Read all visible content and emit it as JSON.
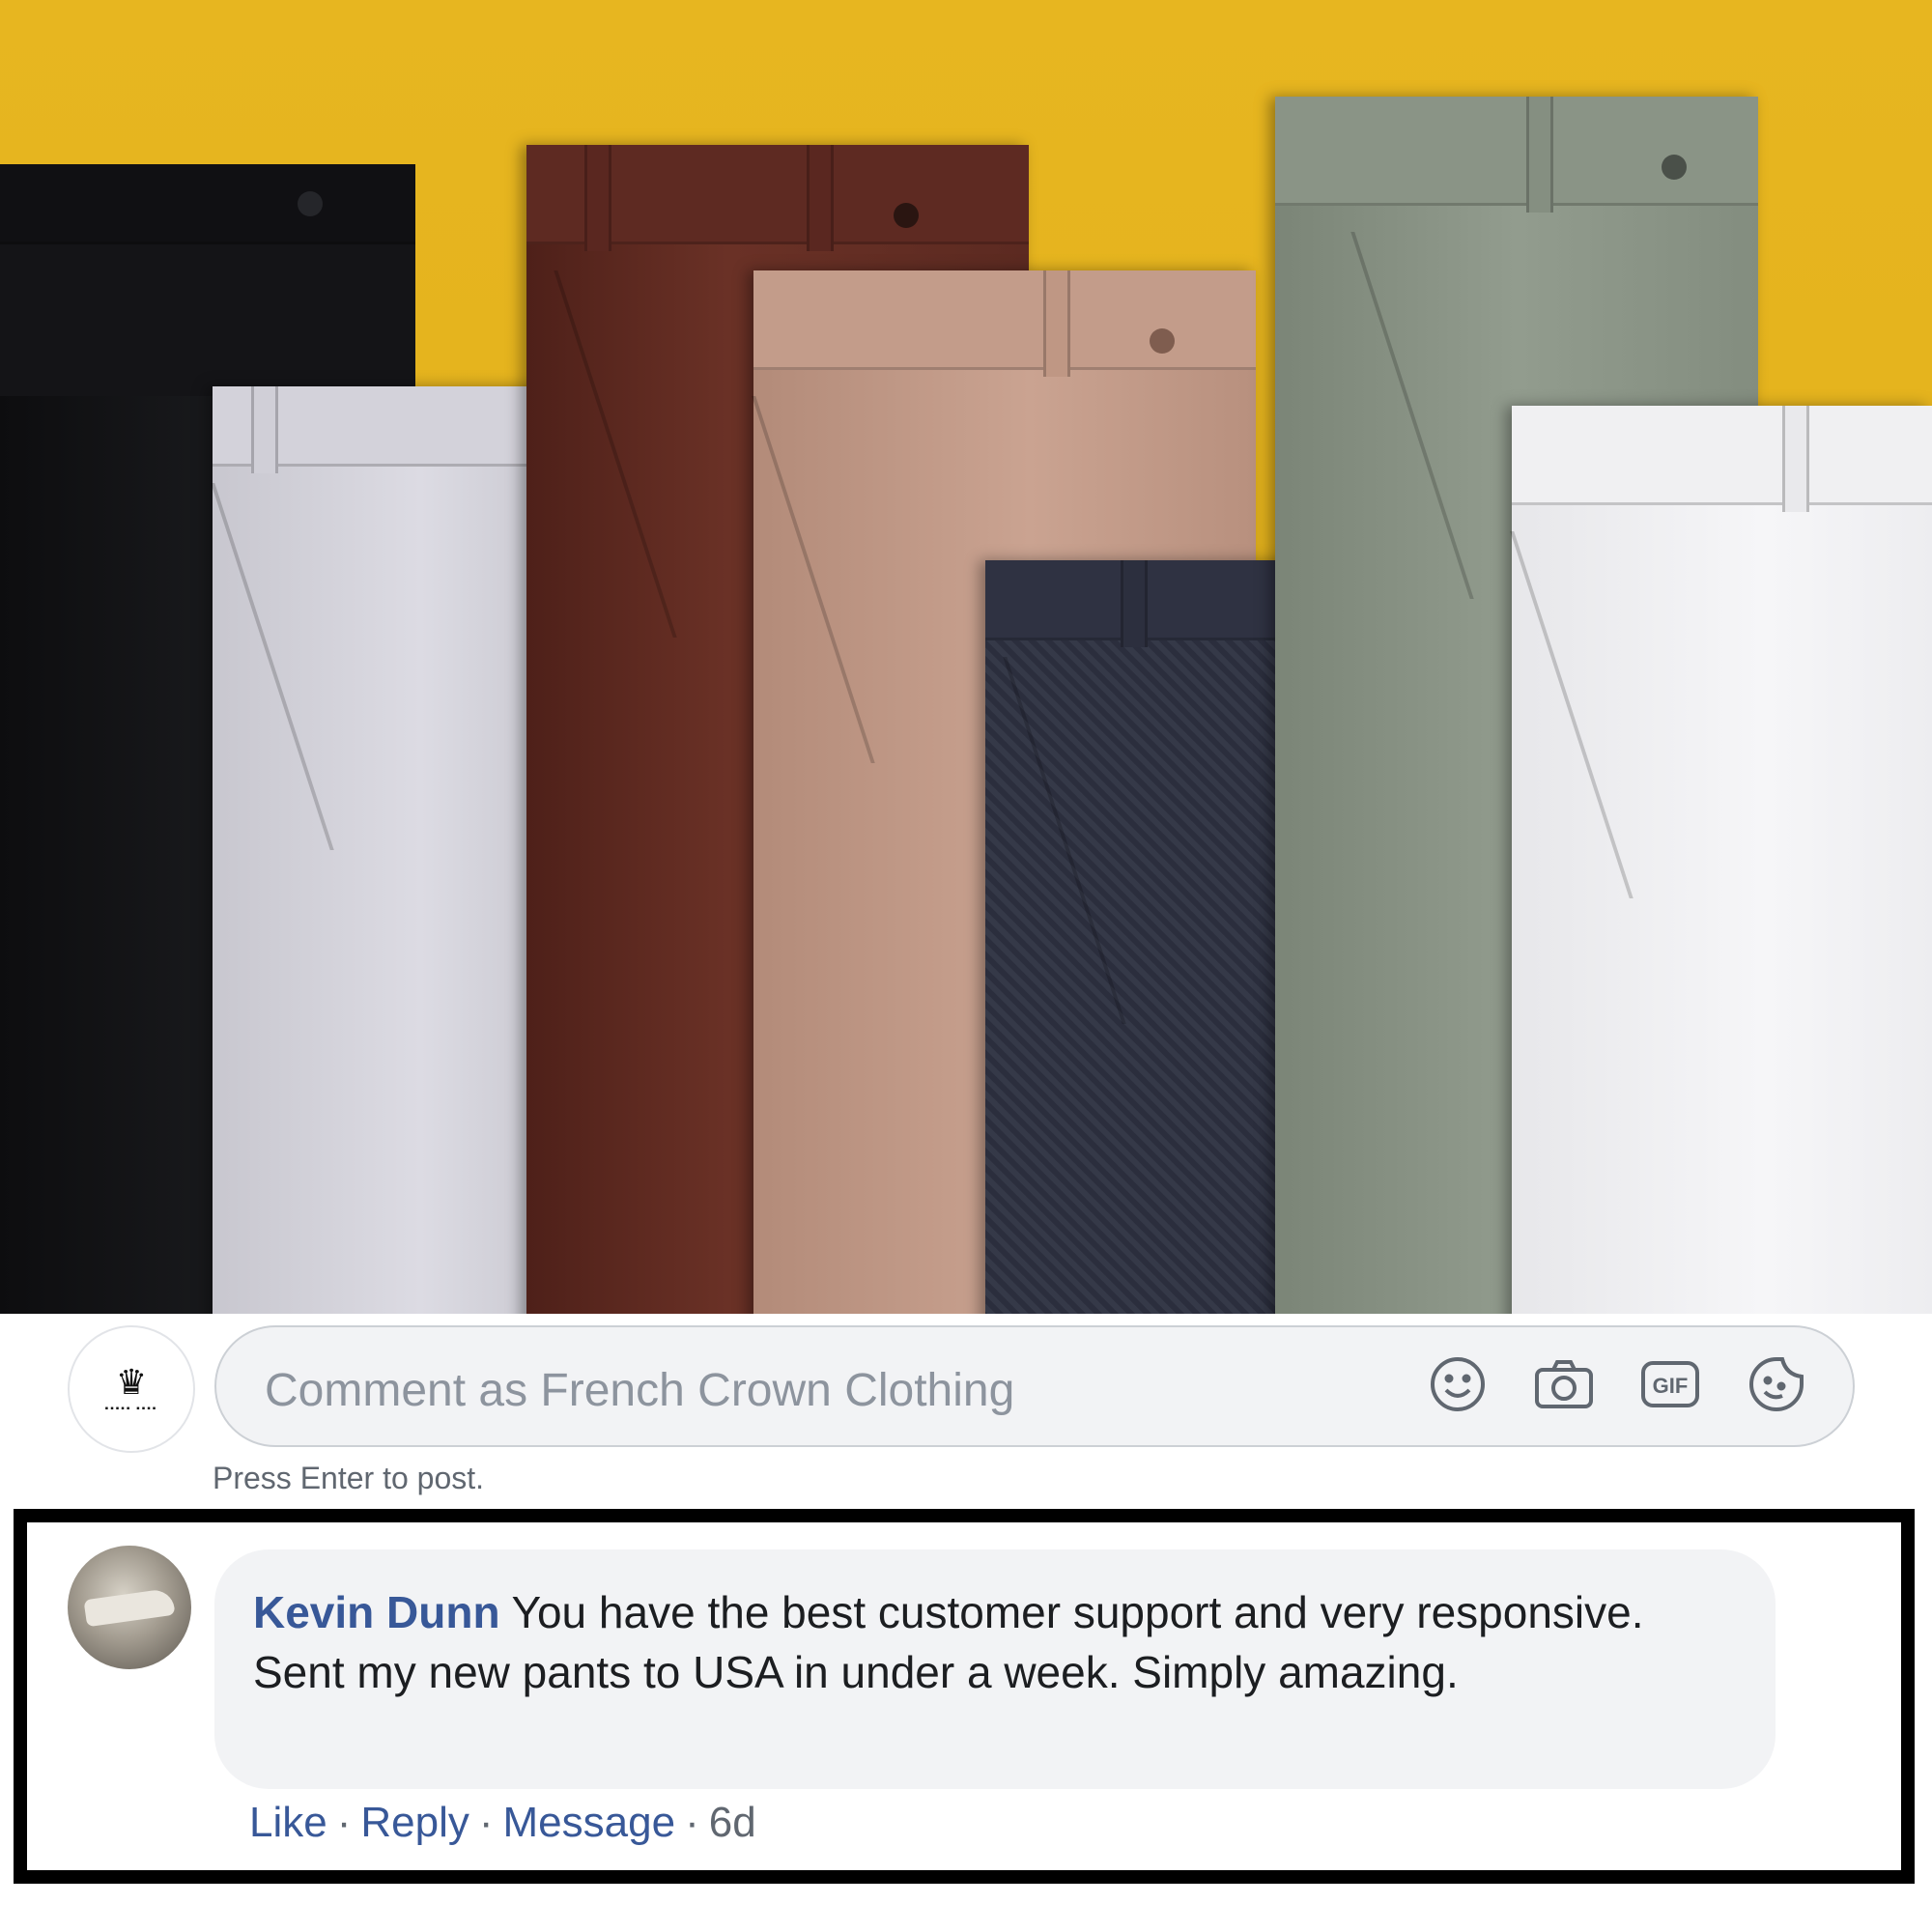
{
  "composer": {
    "placeholder": "Comment as French Crown Clothing",
    "hint": "Press Enter to post.",
    "icons": [
      "smiley-icon",
      "camera-icon",
      "gif-icon",
      "sticker-icon"
    ],
    "gif_label": "GIF"
  },
  "comment": {
    "author": "Kevin Dunn",
    "text": "You have the best customer support and very responsive. Sent my new pants to USA in under a week. Simply amazing.",
    "actions": {
      "like": "Like",
      "reply": "Reply",
      "message": "Message",
      "time": "6d"
    }
  },
  "colors": {
    "background": "#e7b620",
    "link": "#385898",
    "bubble": "#f2f3f5",
    "frame": "#000000"
  }
}
